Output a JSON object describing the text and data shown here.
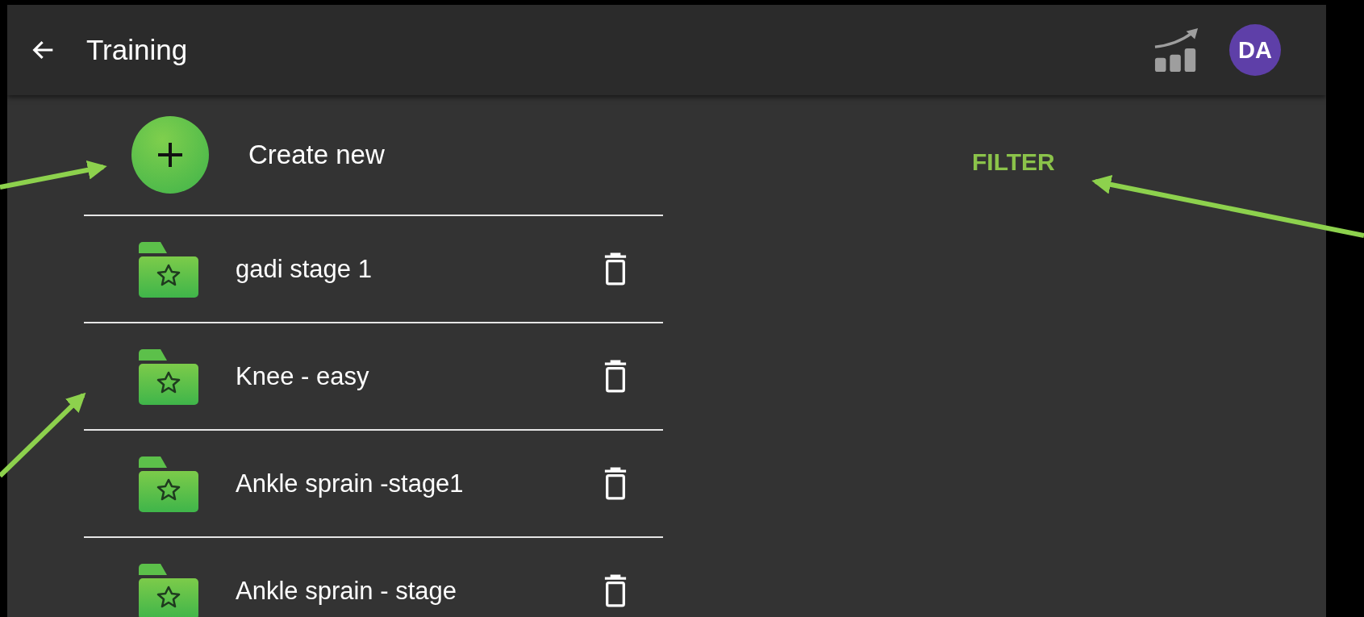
{
  "app_bar": {
    "title": "Training",
    "avatar": "DA"
  },
  "create": {
    "label": "Create new"
  },
  "filter": {
    "label": "FILTER"
  },
  "items": [
    {
      "name": "gadi stage 1"
    },
    {
      "name": "Knee - easy"
    },
    {
      "name": "Ankle sprain -stage1"
    },
    {
      "name": "Ankle sprain - stage"
    }
  ]
}
